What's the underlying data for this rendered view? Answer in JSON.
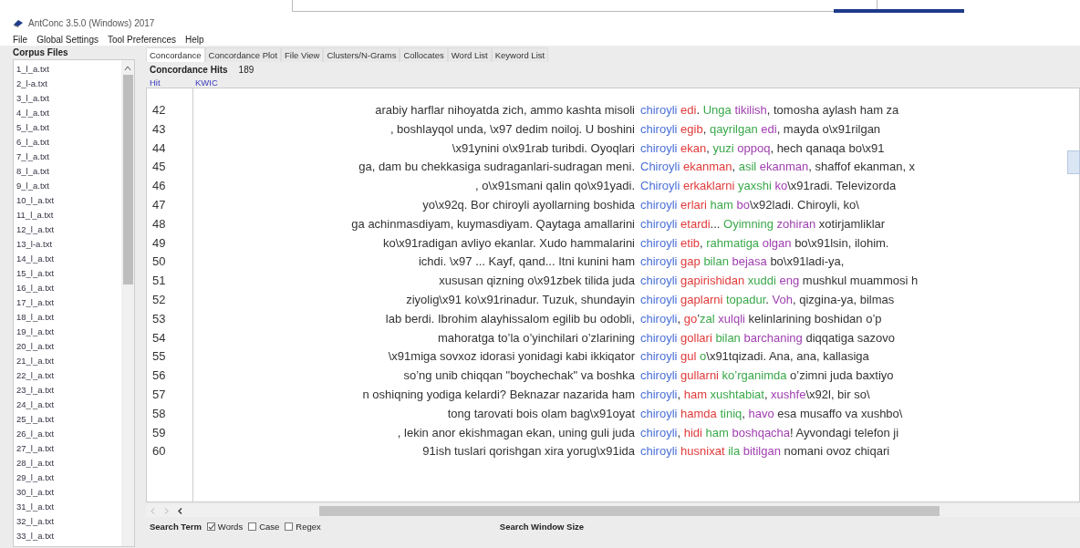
{
  "window": {
    "title": "AntConc 3.5.0 (Windows) 2017"
  },
  "menu": [
    "File",
    "Global Settings",
    "Tool Preferences",
    "Help"
  ],
  "corpus_files": {
    "title": "Corpus Files",
    "items": [
      "1_l_a.txt",
      "2_l-a.txt",
      "3_l_a.txt",
      "4_l_a.txt",
      "5_l_a.txt",
      "6_l_a.txt",
      "7_l_a.txt",
      "8_l_a.txt",
      "9_l_a.txt",
      "10_l_a.txt",
      "11_l_a.txt",
      "12_l_a.txt",
      "13_l-a.txt",
      "14_l_a.txt",
      "15_l_a.txt",
      "16_l_a.txt",
      "17_l_a.txt",
      "18_l_a.txt",
      "19_l_a.txt",
      "20_l_a.txt",
      "21_l_a.txt",
      "22_l_a.txt",
      "23_l_a.txt",
      "24_l_a.txt",
      "25_l_a.txt",
      "26_l_a.txt",
      "27_l_a.txt",
      "28_l_a.txt",
      "29_l_a.txt",
      "30_l_a.txt",
      "31_l_a.txt",
      "32_l_a.txt",
      "33_l_a.txt"
    ]
  },
  "tabs": [
    {
      "label": "Concordance",
      "selected": true
    },
    {
      "label": "Concordance Plot",
      "selected": false
    },
    {
      "label": "File View",
      "selected": false
    },
    {
      "label": "Clusters/N-Grams",
      "selected": false
    },
    {
      "label": "Collocates",
      "selected": false
    },
    {
      "label": "Word List",
      "selected": false
    },
    {
      "label": "Keyword List",
      "selected": false
    }
  ],
  "hits": {
    "label": "Concordance Hits",
    "value": "189"
  },
  "table": {
    "columns": [
      "Hit",
      "KWIC"
    ],
    "rows": [
      {
        "hit": "42",
        "left": "arabiy harflar nihoyatda zich, ammo kashta misoli",
        "parts": [
          {
            "text": "chiroyli",
            "color": "#4a6fd6"
          },
          {
            "text": " edi",
            "color": "#e03a3a"
          },
          {
            "text": "."
          },
          {
            "text": " Unga",
            "color": "#3aa84a"
          },
          {
            "text": " tikilish",
            "color": "#a040b0"
          },
          {
            "text": ", tomosha aylash ham za"
          }
        ]
      },
      {
        "hit": "43",
        "left": ", boshlayqol unda, \\x97 dedim noiloj. U boshini",
        "parts": [
          {
            "text": "chiroyli",
            "color": "#4a6fd6"
          },
          {
            "text": " egib",
            "color": "#e03a3a"
          },
          {
            "text": ","
          },
          {
            "text": " qayrilgan",
            "color": "#3aa84a"
          },
          {
            "text": " edi",
            "color": "#a040b0"
          },
          {
            "text": ", mayda o\\x91rilgan"
          }
        ]
      },
      {
        "hit": "44",
        "left": "\\x91ynini o\\x91rab turibdi. Oyoqlari",
        "parts": [
          {
            "text": "chiroyli",
            "color": "#4a6fd6"
          },
          {
            "text": " ekan",
            "color": "#e03a3a"
          },
          {
            "text": ","
          },
          {
            "text": " yuzi",
            "color": "#3aa84a"
          },
          {
            "text": " oppoq",
            "color": "#a040b0"
          },
          {
            "text": ", hech qanaqa bo\\x91"
          }
        ]
      },
      {
        "hit": "45",
        "left": "ga, dam bu chekkasiga sudraganlari-sudragan meni.",
        "parts": [
          {
            "text": "Chiroyli",
            "color": "#4a6fd6"
          },
          {
            "text": " ekanman",
            "color": "#e03a3a"
          },
          {
            "text": ","
          },
          {
            "text": " asil",
            "color": "#3aa84a"
          },
          {
            "text": " ekanman",
            "color": "#a040b0"
          },
          {
            "text": ", shaffof ekanman, x"
          }
        ]
      },
      {
        "hit": "46",
        "left": ", o\\x91smani qalin qo\\x91yadi.",
        "parts": [
          {
            "text": "Chiroyli",
            "color": "#4a6fd6"
          },
          {
            "text": " erkaklarni",
            "color": "#e03a3a"
          },
          {
            "text": " yaxshi",
            "color": "#3aa84a"
          },
          {
            "text": " ko",
            "color": "#a040b0"
          },
          {
            "text": "\\x91radi. Televizorda"
          }
        ]
      },
      {
        "hit": "47",
        "left": "yo\\x92q. Bor chiroyli ayollarning boshida",
        "parts": [
          {
            "text": "chiroyli",
            "color": "#4a6fd6"
          },
          {
            "text": " erlari",
            "color": "#e03a3a"
          },
          {
            "text": " ham",
            "color": "#3aa84a"
          },
          {
            "text": " bo",
            "color": "#a040b0"
          },
          {
            "text": "\\x92ladi. Chiroyli, ko\\"
          }
        ]
      },
      {
        "hit": "48",
        "left": "ga achinmasdiyam, kuymasdiyam. Qaytaga amallarini",
        "parts": [
          {
            "text": "chiroyli",
            "color": "#4a6fd6"
          },
          {
            "text": " etardi",
            "color": "#e03a3a"
          },
          {
            "text": "..."
          },
          {
            "text": " Oyimning",
            "color": "#3aa84a"
          },
          {
            "text": " zohiran",
            "color": "#a040b0"
          },
          {
            "text": " xotirjamliklar"
          }
        ]
      },
      {
        "hit": "49",
        "left": "ko\\x91radigan avliyo ekanlar. Xudo hammalarini",
        "parts": [
          {
            "text": "chiroyli",
            "color": "#4a6fd6"
          },
          {
            "text": " etib",
            "color": "#e03a3a"
          },
          {
            "text": ","
          },
          {
            "text": " rahmatiga",
            "color": "#3aa84a"
          },
          {
            "text": " olgan",
            "color": "#a040b0"
          },
          {
            "text": " bo\\x91lsin, ilohim."
          }
        ]
      },
      {
        "hit": "50",
        "left": "ichdi. \\x97    ... Kayf, qand... Itni kunini ham",
        "parts": [
          {
            "text": "chiroyli",
            "color": "#4a6fd6"
          },
          {
            "text": " gap",
            "color": "#e03a3a"
          },
          {
            "text": " bilan",
            "color": "#3aa84a"
          },
          {
            "text": " bejasa",
            "color": "#a040b0"
          },
          {
            "text": " bo\\x91ladi-ya,"
          }
        ]
      },
      {
        "hit": "51",
        "left": "xususan qizning o\\x91zbek tilida juda",
        "parts": [
          {
            "text": "chiroyli",
            "color": "#4a6fd6"
          },
          {
            "text": " gapirishidan",
            "color": "#e03a3a"
          },
          {
            "text": " xuddi",
            "color": "#3aa84a"
          },
          {
            "text": " eng",
            "color": "#a040b0"
          },
          {
            "text": " mushkul muammosi h"
          }
        ]
      },
      {
        "hit": "52",
        "left": "ziyolig\\x91 ko\\x91rinadur. Tuzuk, shundayin",
        "parts": [
          {
            "text": "chiroyli",
            "color": "#4a6fd6"
          },
          {
            "text": " gaplarni",
            "color": "#e03a3a"
          },
          {
            "text": " topadur",
            "color": "#3aa84a"
          },
          {
            "text": "."
          },
          {
            "text": " Voh",
            "color": "#a040b0"
          },
          {
            "text": ", qizgina-ya, bilmas"
          }
        ]
      },
      {
        "hit": "53",
        "left": "lab berdi. Ibrohim alayhissalom egilib bu odobli,",
        "parts": [
          {
            "text": "chiroyli",
            "color": "#4a6fd6"
          },
          {
            "text": ","
          },
          {
            "text": " go",
            "color": "#e03a3a"
          },
          {
            "text": "’"
          },
          {
            "text": "zal",
            "color": "#3aa84a"
          },
          {
            "text": " xulqli",
            "color": "#a040b0"
          },
          {
            "text": " kelinlarining boshidan o’p"
          }
        ]
      },
      {
        "hit": "54",
        "left": "mahoratga to’la o’yinchilari o’zlarining",
        "parts": [
          {
            "text": "chiroyli",
            "color": "#4a6fd6"
          },
          {
            "text": " gollari",
            "color": "#e03a3a"
          },
          {
            "text": " bilan",
            "color": "#3aa84a"
          },
          {
            "text": " barchaning",
            "color": "#a040b0"
          },
          {
            "text": " diqqatiga sazovo"
          }
        ]
      },
      {
        "hit": "55",
        "left": "\\x91miga sovxoz idorasi yonidagi kabi ikkiqator",
        "parts": [
          {
            "text": "chiroyli",
            "color": "#4a6fd6"
          },
          {
            "text": " gul",
            "color": "#e03a3a"
          },
          {
            "text": " o",
            "color": "#3aa84a"
          },
          {
            "text": "\\x91tqizadi. Ana, ana, kallasiga"
          }
        ]
      },
      {
        "hit": "56",
        "left": "so’ng unib chiqqan \"boychechak\" va boshka",
        "parts": [
          {
            "text": "chiroyli",
            "color": "#4a6fd6"
          },
          {
            "text": " gullarni",
            "color": "#e03a3a"
          },
          {
            "text": " ko’rganimda",
            "color": "#3aa84a"
          },
          {
            "text": " o’zimni juda baxtiyo"
          }
        ]
      },
      {
        "hit": "57",
        "left": "n oshiqning yodiga kelardi? Beknazar nazarida ham",
        "parts": [
          {
            "text": "chiroyli",
            "color": "#4a6fd6"
          },
          {
            "text": ","
          },
          {
            "text": " ham",
            "color": "#e03a3a"
          },
          {
            "text": " xushtabiat",
            "color": "#3aa84a"
          },
          {
            "text": ","
          },
          {
            "text": " xushfe",
            "color": "#a040b0"
          },
          {
            "text": "\\x92l, bir so\\"
          }
        ]
      },
      {
        "hit": "58",
        "left": "tong tarovati bois olam bag\\x91oyat",
        "parts": [
          {
            "text": "chiroyli",
            "color": "#4a6fd6"
          },
          {
            "text": " hamda",
            "color": "#e03a3a"
          },
          {
            "text": " tiniq",
            "color": "#3aa84a"
          },
          {
            "text": ","
          },
          {
            "text": " havo",
            "color": "#a040b0"
          },
          {
            "text": " esa musaffo va xushbo\\"
          }
        ]
      },
      {
        "hit": "59",
        "left": ", lekin anor ekishmagan ekan, uning guli juda",
        "parts": [
          {
            "text": "chiroyli",
            "color": "#4a6fd6"
          },
          {
            "text": ","
          },
          {
            "text": " hidi",
            "color": "#e03a3a"
          },
          {
            "text": " ham",
            "color": "#3aa84a"
          },
          {
            "text": " boshqacha",
            "color": "#a040b0"
          },
          {
            "text": "! Ayvondagi telefon ji"
          }
        ]
      },
      {
        "hit": "60",
        "left": "91ish tuslari qorishgan xira yorug\\x91ida",
        "parts": [
          {
            "text": "chiroyli",
            "color": "#4a6fd6"
          },
          {
            "text": " husnixat",
            "color": "#e03a3a"
          },
          {
            "text": " ila",
            "color": "#3aa84a"
          },
          {
            "text": " bitilgan",
            "color": "#a040b0"
          },
          {
            "text": " nomani ovoz chiqari"
          }
        ]
      }
    ]
  },
  "search": {
    "label": "Search Term",
    "options": [
      {
        "label": "Words",
        "checked": true
      },
      {
        "label": "Case",
        "checked": false
      },
      {
        "label": "Regex",
        "checked": false
      }
    ],
    "window_size_label": "Search Window Size"
  }
}
